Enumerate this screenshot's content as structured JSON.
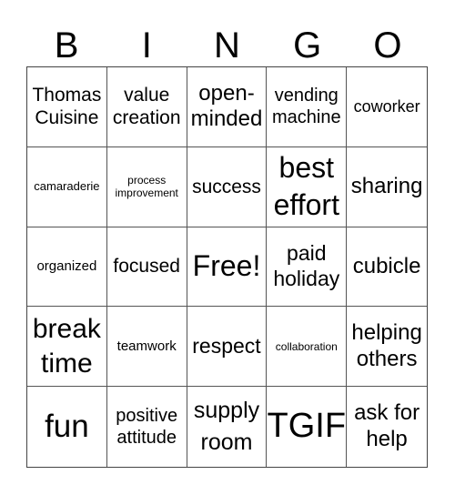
{
  "header": [
    "B",
    "I",
    "N",
    "G",
    "O"
  ],
  "cells": [
    "Thomas Cuisine",
    "value creation",
    "open-minded",
    "vending machine",
    "coworker",
    "camaraderie",
    "process improvement",
    "success",
    "best effort",
    "sharing",
    "organized",
    "focused",
    "Free!",
    "paid holiday",
    "cubicle",
    "break time",
    "teamwork",
    "respect",
    "collaboration",
    "helping others",
    "fun",
    "positive attitude",
    "supply room",
    "TGIF",
    "ask for help"
  ]
}
